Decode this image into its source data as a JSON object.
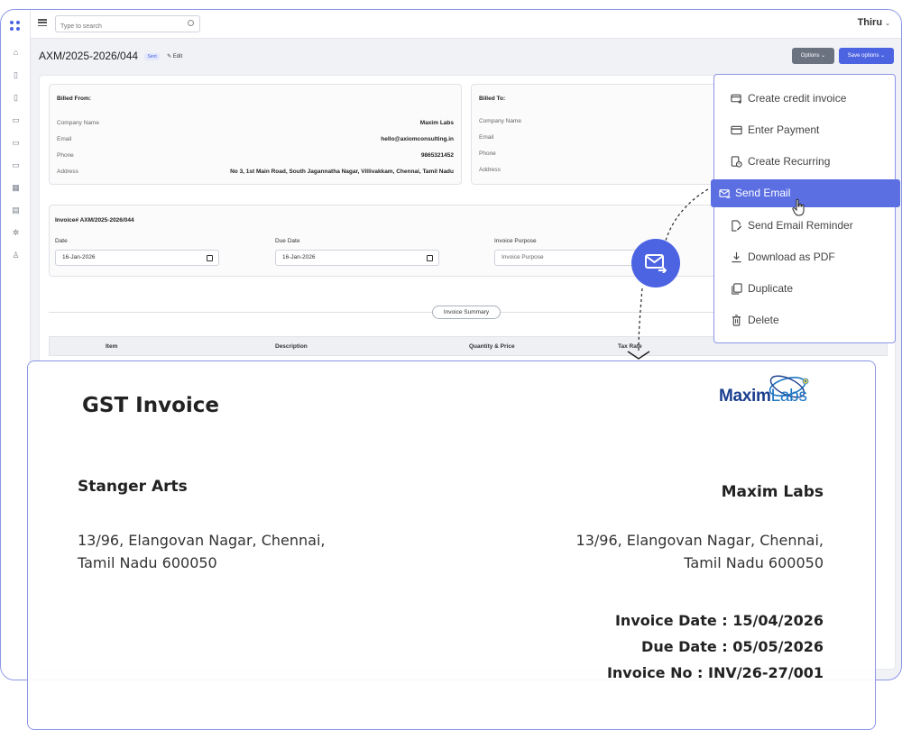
{
  "topbar": {
    "search_placeholder": "Type to search",
    "user_name": "Thiru"
  },
  "page": {
    "title": "AXM/2025-2026/044",
    "status": "Sent",
    "edit_label": "Edit"
  },
  "toolbar": {
    "options_label": "Options",
    "save_options_label": "Save options"
  },
  "billed_from": {
    "heading": "Billed From:",
    "rows": [
      {
        "label": "Company Name",
        "value": "Maxim Labs"
      },
      {
        "label": "Email",
        "value": "hello@axiomconsulting.in"
      },
      {
        "label": "Phone",
        "value": "9865321452"
      },
      {
        "label": "Address",
        "value": "No 3, 1st Main Road, South Jagannatha Nagar, Villivakkam, Chennai, Tamil Nadu"
      }
    ]
  },
  "billed_to": {
    "heading": "Billed To:",
    "rows": [
      {
        "label": "Company Name"
      },
      {
        "label": "Email"
      },
      {
        "label": "Phone"
      },
      {
        "label": "Address"
      }
    ]
  },
  "invoice_info": {
    "heading": "Invoice# AXM/2025-2026/044",
    "date_label": "Date",
    "date_value": "16-Jan-2026",
    "due_label": "Due Date",
    "due_value": "16-Jan-2026",
    "purpose_label": "Invoice Purpose",
    "purpose_placeholder": "Invoice Purpose"
  },
  "summary_label": "Invoice Summary",
  "table_headers": [
    "Item",
    "Description",
    "Quantity & Price",
    "Tax Rate"
  ],
  "options_menu": [
    {
      "label": "Create credit invoice",
      "icon": "credit-card-plus-icon"
    },
    {
      "label": "Enter Payment",
      "icon": "credit-card-icon"
    },
    {
      "label": "Create Recurring",
      "icon": "recurring-doc-icon"
    },
    {
      "label": "Send Email",
      "icon": "mail-send-icon",
      "active": true
    },
    {
      "label": "Send Email Reminder",
      "icon": "doc-edit-icon"
    },
    {
      "label": "Download as PDF",
      "icon": "download-icon"
    },
    {
      "label": "Duplicate",
      "icon": "copy-icon"
    },
    {
      "label": "Delete",
      "icon": "trash-icon"
    }
  ],
  "invoice_preview": {
    "title": "GST Invoice",
    "logo_text_1": "Maxim",
    "logo_text_2": "Labs",
    "client_name": "Stanger Arts",
    "client_address_1": "13/96, Elangovan Nagar, Chennai,",
    "client_address_2": "Tamil Nadu 600050",
    "company_name": "Maxim Labs",
    "company_address_1": "13/96, Elangovan Nagar, Chennai,",
    "company_address_2": "Tamil Nadu 600050",
    "invoice_date": "Invoice Date : 15/04/2026",
    "due_date": "Due Date : 05/05/2026",
    "invoice_no": "Invoice No : INV/26-27/001"
  },
  "colors": {
    "accent": "#4c63e2",
    "menu_active": "#5b6fe3",
    "border": "#8b95e8"
  }
}
